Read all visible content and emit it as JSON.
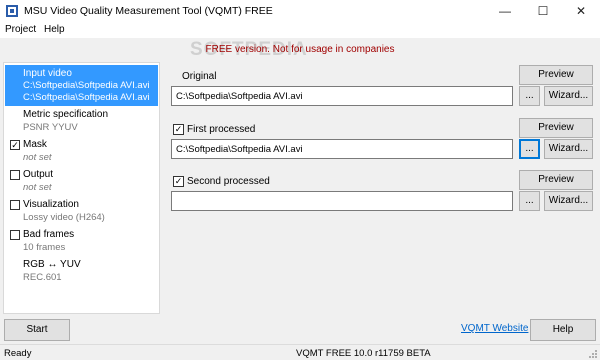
{
  "window": {
    "title": "MSU Video Quality Measurement Tool (VQMT) FREE",
    "minimize_glyph": "—",
    "maximize_glyph": "☐",
    "close_glyph": "✕"
  },
  "menu": [
    "Project",
    "Help"
  ],
  "banner": {
    "watermark": "SOFTPEDIA",
    "notice": "FREE version. Not for usage in companies"
  },
  "sidebar": {
    "items": [
      {
        "title": "Input video",
        "subs": [
          "C:\\Softpedia\\Softpedia AVI.avi",
          "C:\\Softpedia\\Softpedia AVI.avi"
        ],
        "selected": true,
        "checkbox": false
      },
      {
        "title": "Metric specification",
        "subs": [
          "PSNR YYUV"
        ],
        "selected": false,
        "checkbox": false
      },
      {
        "title": "Mask",
        "subs": [
          "not set"
        ],
        "selected": false,
        "checkbox": true,
        "checked": true
      },
      {
        "title": "Output",
        "subs": [
          "not set"
        ],
        "selected": false,
        "checkbox": true,
        "checked": false
      },
      {
        "title": "Visualization",
        "subs": [
          "Lossy video (H264)"
        ],
        "selected": false,
        "checkbox": true,
        "checked": false
      },
      {
        "title": "Bad frames",
        "subs": [
          "10 frames"
        ],
        "selected": false,
        "checkbox": true,
        "checked": false
      },
      {
        "title": "RGB ↔ YUV",
        "subs": [
          "REC.601"
        ],
        "selected": false,
        "checkbox": false
      }
    ]
  },
  "original": {
    "label": "Original",
    "path": "C:\\Softpedia\\Softpedia AVI.avi",
    "preview": "Preview",
    "browse": "...",
    "wizard": "Wizard..."
  },
  "first": {
    "label": "First processed",
    "checked": true,
    "path": "C:\\Softpedia\\Softpedia AVI.avi",
    "preview": "Preview",
    "browse": "...",
    "wizard": "Wizard..."
  },
  "second": {
    "label": "Second processed",
    "checked": true,
    "path": "",
    "preview": "Preview",
    "browse": "...",
    "wizard": "Wizard..."
  },
  "bottom": {
    "start": "Start",
    "link": "VQMT Website",
    "help": "Help"
  },
  "status": {
    "state": "Ready",
    "version": "VQMT FREE 10.0 r11759 BETA"
  },
  "colors": {
    "selection": "#3399ff",
    "notice": "#a00000",
    "link": "#0066cc"
  }
}
